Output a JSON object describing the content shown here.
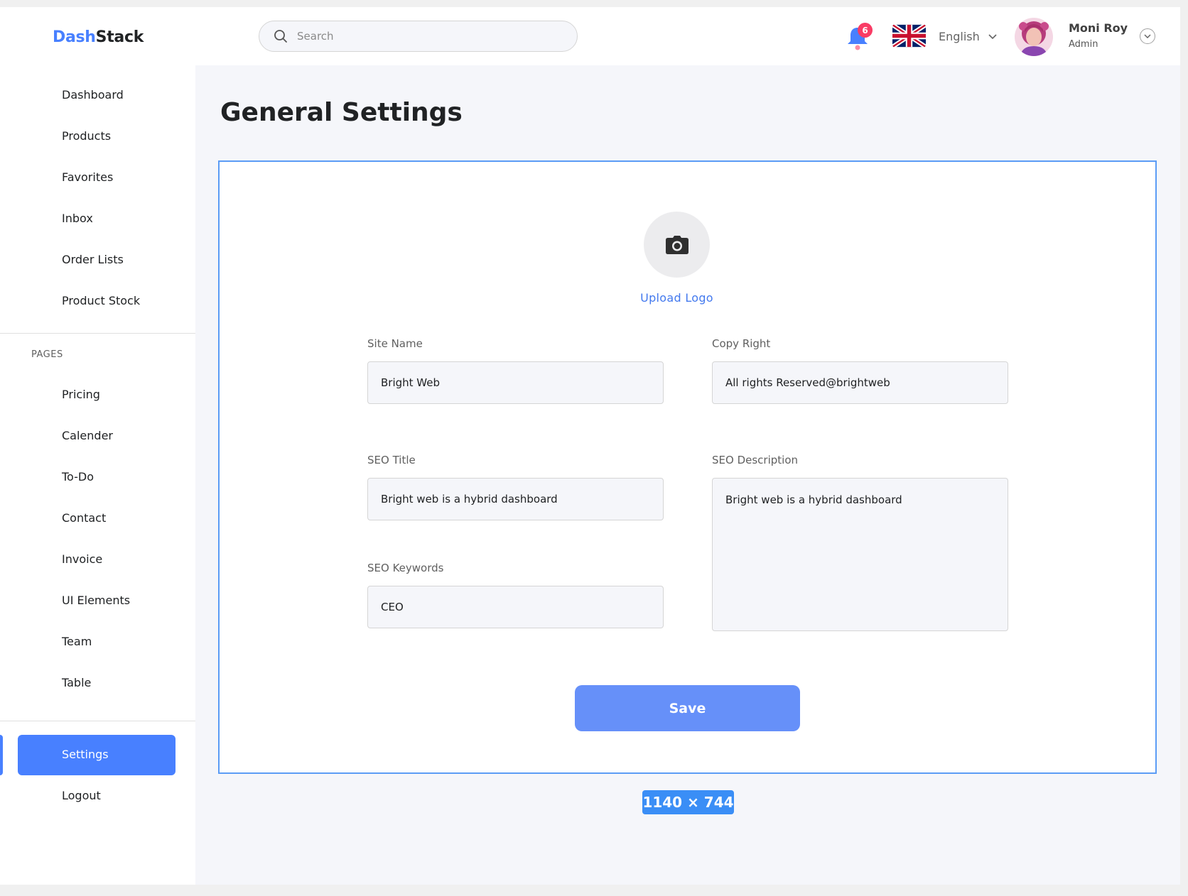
{
  "brand": {
    "part1": "Dash",
    "part2": "Stack"
  },
  "search": {
    "placeholder": "Search"
  },
  "notifications": {
    "count": "6"
  },
  "language": {
    "label": "English"
  },
  "user": {
    "name": "Moni Roy",
    "role": "Admin"
  },
  "sidebar": {
    "items": [
      {
        "label": "Dashboard"
      },
      {
        "label": "Products"
      },
      {
        "label": "Favorites"
      },
      {
        "label": "Inbox"
      },
      {
        "label": "Order Lists"
      },
      {
        "label": "Product Stock"
      }
    ],
    "pages_label": "PAGES",
    "pages": [
      {
        "label": "Pricing"
      },
      {
        "label": "Calender"
      },
      {
        "label": "To-Do"
      },
      {
        "label": "Contact"
      },
      {
        "label": "Invoice"
      },
      {
        "label": "UI Elements"
      },
      {
        "label": "Team"
      },
      {
        "label": "Table"
      }
    ],
    "settings": "Settings",
    "logout": "Logout"
  },
  "main": {
    "title": "General Settings",
    "upload_label": "Upload Logo",
    "fields": {
      "site_name": {
        "label": "Site Name",
        "value": "Bright Web"
      },
      "copy_right": {
        "label": "Copy Right",
        "value": "All rights Reserved@brightweb"
      },
      "seo_title": {
        "label": "SEO Title",
        "value": "Bright web is a hybrid dashboard"
      },
      "seo_description": {
        "label": "SEO Description",
        "value": "Bright web is a hybrid dashboard"
      },
      "seo_keywords": {
        "label": "SEO Keywords",
        "value": "CEO"
      }
    },
    "save_label": "Save",
    "dimensions_badge": "1140 × 744"
  },
  "colors": {
    "accent": "#4880ff",
    "save_button": "#6690f9",
    "badge": "#f93c65",
    "selection_outline": "#5b9cf5"
  }
}
